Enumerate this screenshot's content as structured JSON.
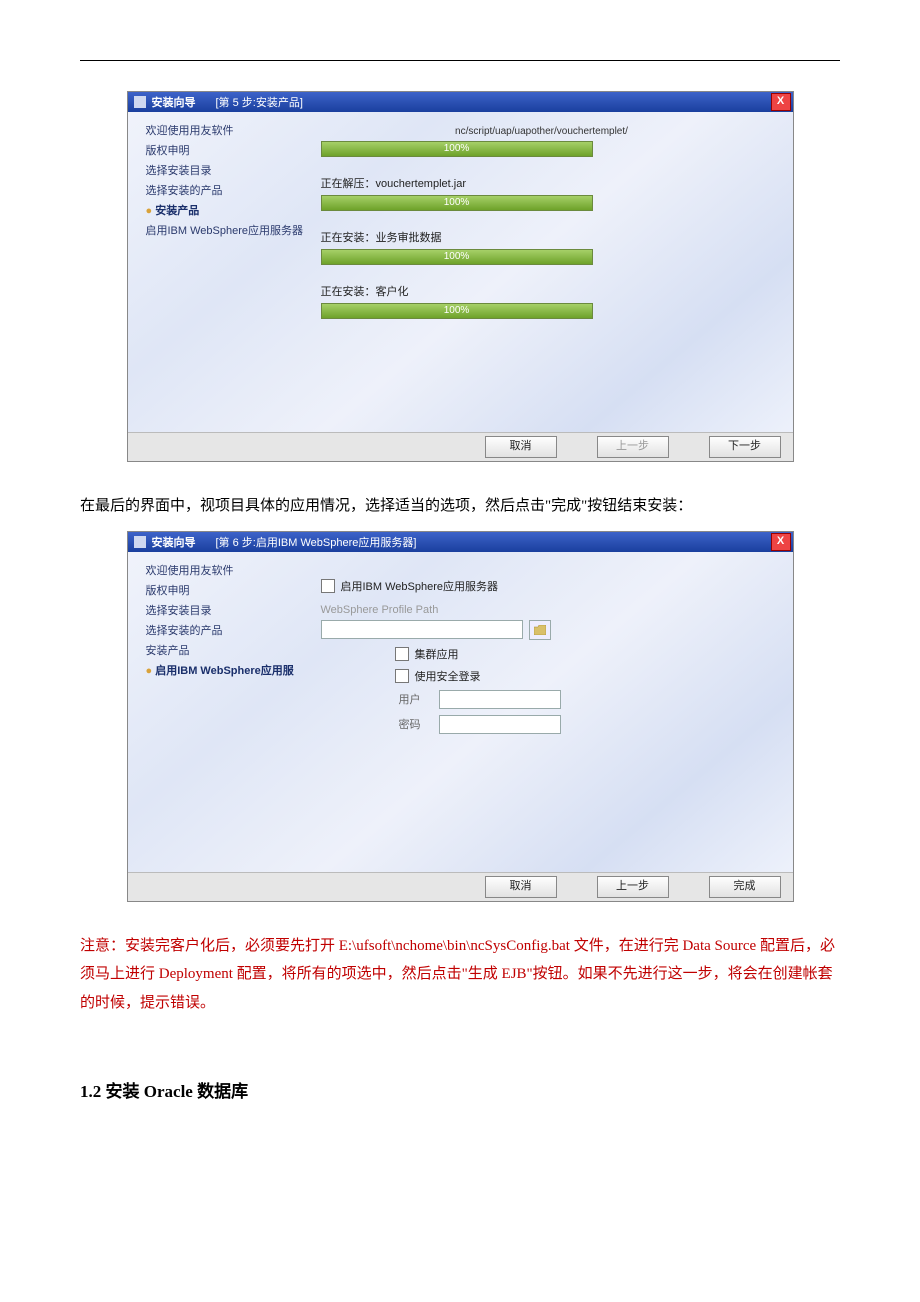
{
  "shot1": {
    "title_main": "安装向导",
    "title_sub": "[第 5 步:安装产品]",
    "close": "X",
    "side_items": [
      "欢迎使用用友软件",
      "版权申明",
      "选择安装目录",
      "选择安装的产品"
    ],
    "side_current": "安装产品",
    "side_after": [
      "启用IBM WebSphere应用服务器"
    ],
    "path": "nc/script/uap/uapother/vouchertemplet/",
    "p1_label": "",
    "p1_pct": "100%",
    "p2_label": "正在解压：vouchertemplet.jar",
    "p2_pct": "100%",
    "p3_label": "正在安装：业务审批数据",
    "p3_pct": "100%",
    "p4_label": "正在安装：客户化",
    "p4_pct": "100%",
    "btn_cancel": "取消",
    "btn_prev": "上一步",
    "btn_next": "下一步"
  },
  "para1": "在最后的界面中，视项目具体的应用情况，选择适当的选项，然后点击\"完成\"按钮结束安装：",
  "shot2": {
    "title_main": "安装向导",
    "title_sub": "[第 6 步:启用IBM WebSphere应用服务器]",
    "close": "X",
    "side_items": [
      "欢迎使用用友软件",
      "版权申明",
      "选择安装目录",
      "选择安装的产品",
      "安装产品"
    ],
    "side_current": "启用IBM WebSphere应用服",
    "chk_enable": "启用IBM WebSphere应用服务器",
    "label_path": "WebSphere Profile Path",
    "chk_cluster": "集群应用",
    "chk_secure": "使用安全登录",
    "label_user": "用户",
    "label_pass": "密码",
    "btn_cancel": "取消",
    "btn_prev": "上一步",
    "btn_finish": "完成"
  },
  "redpara": "注意：安装完客户化后，必须要先打开 E:\\ufsoft\\nchome\\bin\\ncSysConfig.bat 文件，在进行完 Data Source 配置后，必须马上进行 Deployment 配置，将所有的项选中，然后点击\"生成 EJB\"按钮。如果不先进行这一步，将会在创建帐套的时候，提示错误。",
  "heading": "1.2  安装 Oracle 数据库"
}
